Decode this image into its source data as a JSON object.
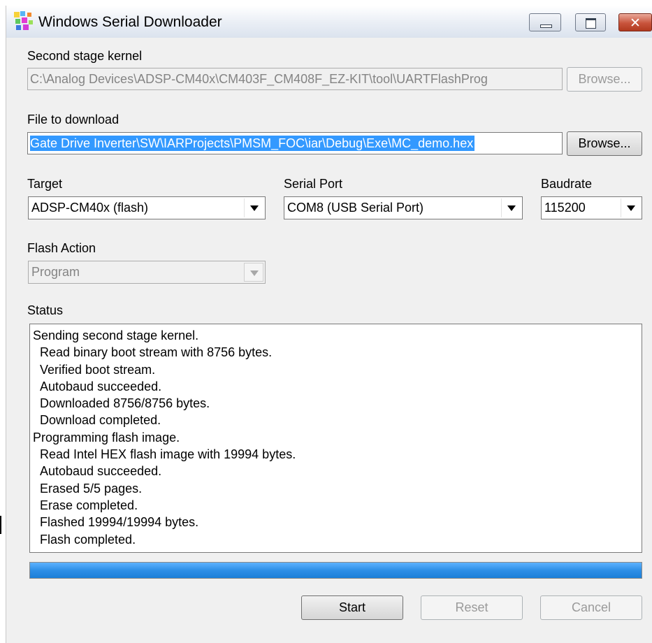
{
  "window": {
    "title": "Windows Serial Downloader",
    "caption_buttons": {
      "minimize": "minimize-icon",
      "maximize": "maximize-icon",
      "close": "✕"
    }
  },
  "second_stage_kernel": {
    "label": "Second stage kernel",
    "path": "C:\\Analog Devices\\ADSP-CM40x\\CM403F_CM408F_EZ-KIT\\tool\\UARTFlashProg",
    "browse_label": "Browse..."
  },
  "file_to_download": {
    "label": "File to download",
    "path": " Gate Drive Inverter\\SW\\IARProjects\\PMSM_FOC\\iar\\Debug\\Exe\\MC_demo.hex",
    "browse_label": "Browse..."
  },
  "target": {
    "label": "Target",
    "value": "ADSP-CM40x (flash)"
  },
  "serial_port": {
    "label": "Serial Port",
    "value": "COM8 (USB Serial Port)"
  },
  "baudrate": {
    "label": "Baudrate",
    "value": "115200"
  },
  "flash_action": {
    "label": "Flash Action",
    "value": "Program"
  },
  "status": {
    "label": "Status",
    "lines": [
      {
        "text": "Sending second stage kernel.",
        "indent": false
      },
      {
        "text": "Read binary boot stream with 8756 bytes.",
        "indent": true
      },
      {
        "text": "Verified boot stream.",
        "indent": true
      },
      {
        "text": "Autobaud succeeded.",
        "indent": true
      },
      {
        "text": "Downloaded 8756/8756 bytes.",
        "indent": true
      },
      {
        "text": "Download completed.",
        "indent": true
      },
      {
        "text": "Programming flash image.",
        "indent": false
      },
      {
        "text": "Read Intel HEX flash image with 19994 bytes.",
        "indent": true
      },
      {
        "text": "Autobaud succeeded.",
        "indent": true
      },
      {
        "text": "Erased 5/5 pages.",
        "indent": true
      },
      {
        "text": "Erase completed.",
        "indent": true
      },
      {
        "text": "Flashed 19994/19994 bytes.",
        "indent": true
      },
      {
        "text": "Flash completed.",
        "indent": true
      }
    ]
  },
  "progress": {
    "fraction": 1.0,
    "color": "#2e8fe6"
  },
  "buttons": {
    "start": "Start",
    "reset": "Reset",
    "cancel": "Cancel"
  },
  "icons": {
    "app": "app-icon"
  },
  "colors": {
    "selection": "#3399ff",
    "close_button": "#c8543c",
    "window_bg": "#f0f0f0"
  }
}
